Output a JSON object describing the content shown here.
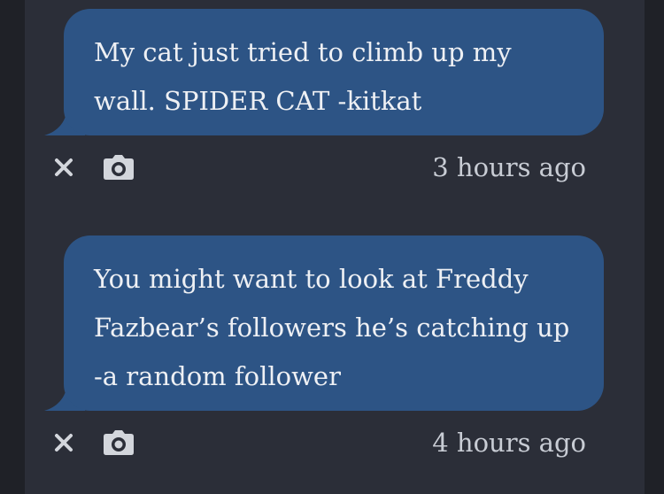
{
  "messages": [
    {
      "text": "My cat just tried to climb up my\nwall. SPIDER CAT -kitkat",
      "time": "3 hours ago",
      "delete_icon": "close-icon",
      "photo_icon": "camera-icon"
    },
    {
      "text": "You might want to look at Freddy\nFazbear’s followers he’s catching up\n-a random follower",
      "time": "4 hours ago",
      "delete_icon": "close-icon",
      "photo_icon": "camera-icon"
    }
  ],
  "colors": {
    "background": "#1f2127",
    "panel": "#2b2e38",
    "bubble": "#2d5485",
    "bubble_text": "#eef0f4",
    "meta_text": "#c8ccd4",
    "icon": "#d3d6dc"
  }
}
